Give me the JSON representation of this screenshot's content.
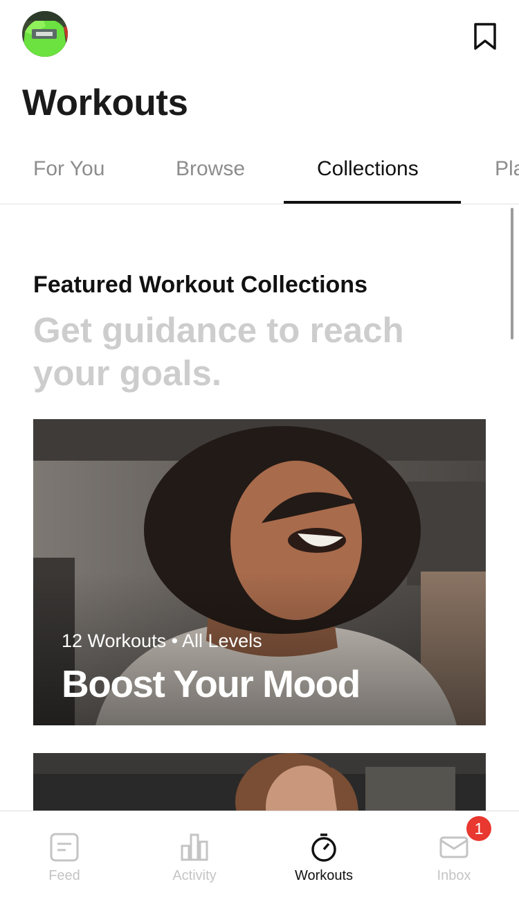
{
  "header": {
    "title": "Workouts"
  },
  "tabs": [
    {
      "label": "For You"
    },
    {
      "label": "Browse"
    },
    {
      "label": "Collections",
      "active": true
    },
    {
      "label": "Plans"
    }
  ],
  "section": {
    "title": "Featured Workout Collections",
    "subtitle": "Get guidance to reach your goals."
  },
  "cards": [
    {
      "meta": "12 Workouts • All Levels",
      "title": "Boost Your Mood"
    }
  ],
  "bottom_nav": {
    "items": [
      {
        "label": "Feed",
        "icon": "feed-icon"
      },
      {
        "label": "Activity",
        "icon": "activity-icon"
      },
      {
        "label": "Workouts",
        "icon": "stopwatch-icon",
        "active": true
      },
      {
        "label": "Inbox",
        "icon": "inbox-icon",
        "badge": "1"
      }
    ]
  },
  "colors": {
    "badge": "#e8382f",
    "active": "#111111",
    "inactive": "#c4c4c4",
    "subtitle": "#cdcdcd"
  }
}
